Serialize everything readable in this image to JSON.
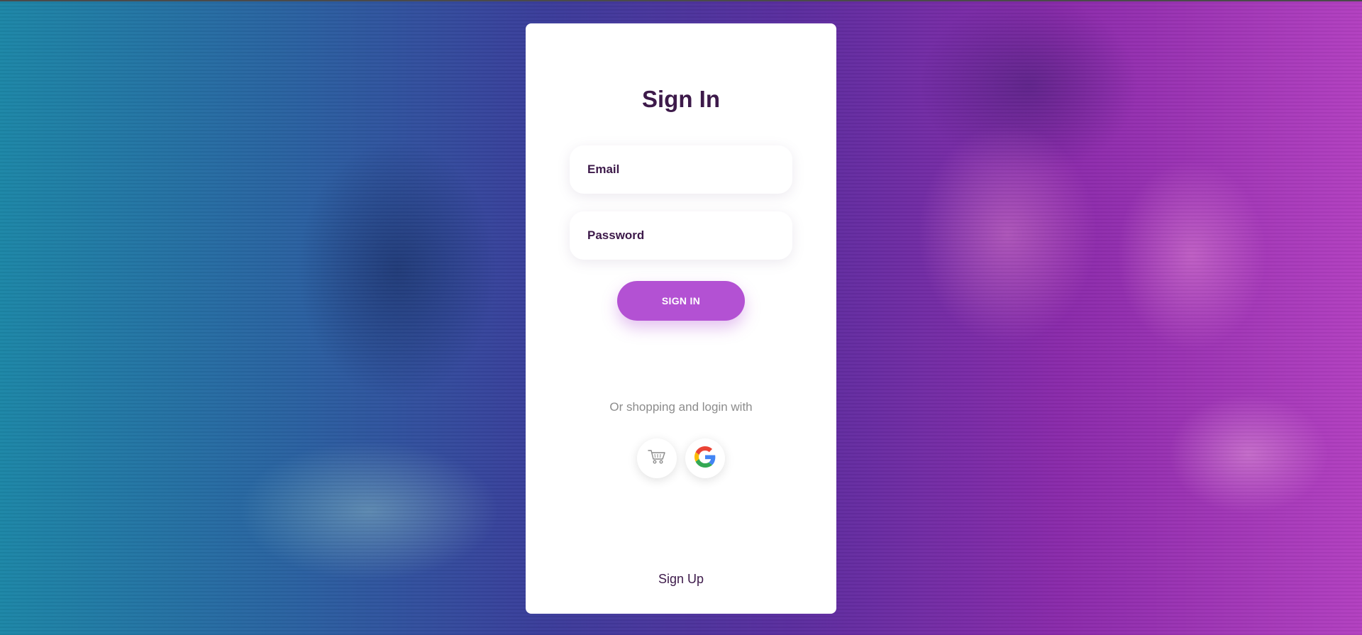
{
  "form": {
    "title": "Sign In",
    "email_placeholder": "Email",
    "password_placeholder": "Password",
    "signin_label": "SIGN IN",
    "alt_login_text": "Or shopping and login with",
    "signup_label": "Sign Up"
  },
  "social": [
    {
      "icon": "shopping-cart-icon"
    },
    {
      "icon": "google-icon"
    }
  ],
  "colors": {
    "title": "#3d1a4a",
    "button": "#b351d3",
    "alt_text": "#8c8c8c"
  }
}
